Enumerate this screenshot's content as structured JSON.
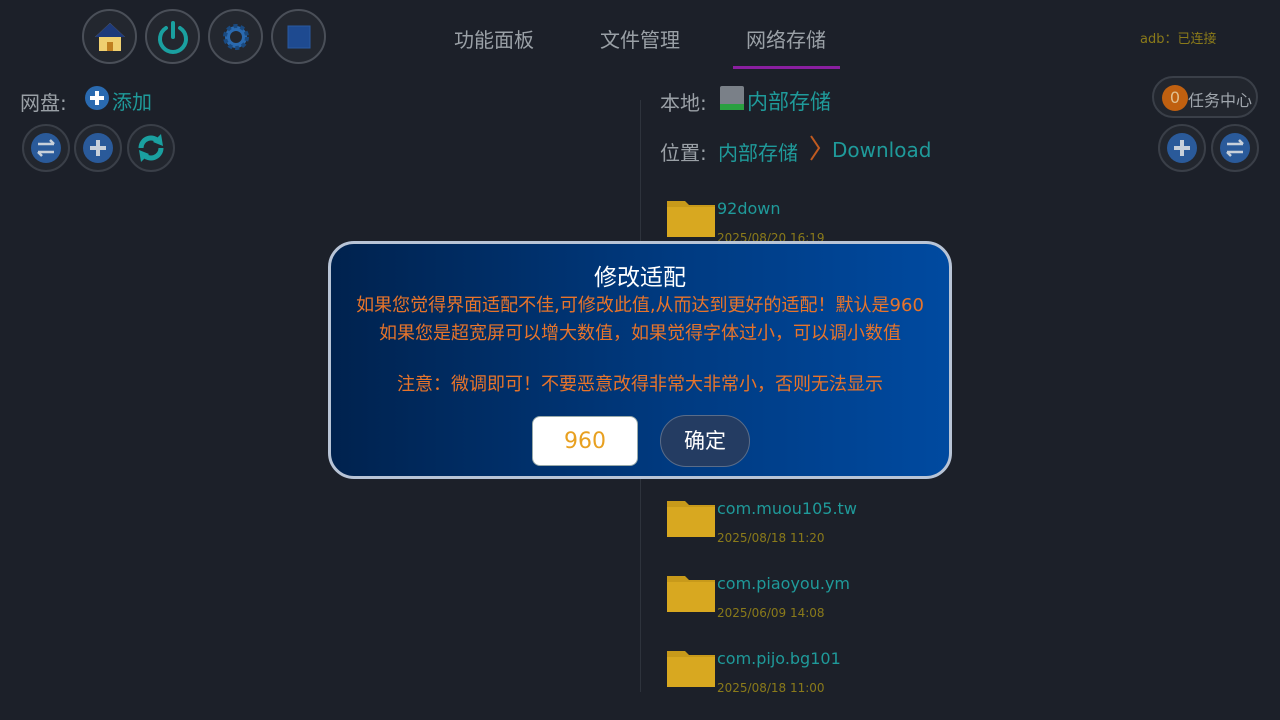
{
  "topbar": {
    "icons": [
      "home-icon",
      "power-icon",
      "settings-icon",
      "stop-icon"
    ],
    "tabs": [
      {
        "label": "功能面板"
      },
      {
        "label": "文件管理"
      },
      {
        "label": "网络存储"
      }
    ],
    "active_tab": 2,
    "adb_status": "adb：已连接"
  },
  "left": {
    "netdisk_label": "网盘:",
    "add_label": "添加",
    "buttons": [
      "swap-icon",
      "plus-icon",
      "refresh-icon"
    ]
  },
  "right": {
    "local_label": "本地:",
    "storage_name": "内部存储",
    "location_label": "位置:",
    "breadcrumb": [
      "内部存储",
      "Download"
    ],
    "task_count": "0",
    "task_label": "任务中心",
    "files": [
      {
        "name": "92down",
        "date": "2025/08/20 16:19"
      },
      {
        "name": "com.muou105.tw",
        "date": "2025/08/18 11:20"
      },
      {
        "name": "com.piaoyou.ym",
        "date": "2025/06/09 14:08"
      },
      {
        "name": "com.pijo.bg101",
        "date": "2025/08/18 11:00"
      }
    ]
  },
  "dialog": {
    "title": "修改适配",
    "line1": "如果您觉得界面适配不佳,可修改此值,从而达到更好的适配！默认是960",
    "line2": "如果您是超宽屏可以增大数值，如果觉得字体过小，可以调小数值",
    "line3": "注意：微调即可！不要恶意改得非常大非常小，否则无法显示",
    "input_value": "960",
    "confirm_label": "确定"
  },
  "colors": {
    "background": "#1c2029",
    "accent_teal": "#1f9a9a",
    "tab_underline": "#8a1fa0",
    "dialog_text": "#e8742a"
  }
}
